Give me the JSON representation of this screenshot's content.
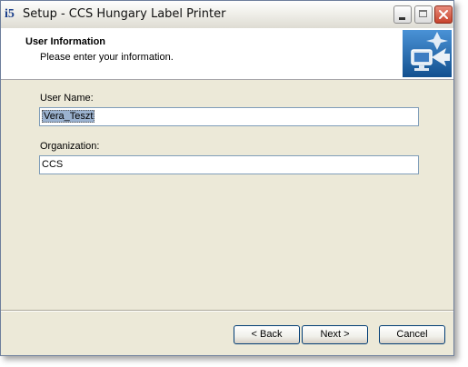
{
  "window": {
    "title": "Setup - CCS Hungary Label Printer",
    "app_icon_glyph": "i5",
    "icons": [
      "setup-app-icon",
      "minimize-icon",
      "maximize-icon",
      "close-icon",
      "wizard-computer-icon"
    ]
  },
  "header": {
    "title": "User Information",
    "subtitle": "Please enter your information."
  },
  "form": {
    "user_name_label": "User Name:",
    "user_name_value": "Vera_Teszt",
    "organization_label": "Organization:",
    "organization_value": "CCS"
  },
  "buttons": {
    "back": "< Back",
    "next": "Next >",
    "cancel": "Cancel"
  },
  "colors": {
    "dialog_background": "#ece9d8",
    "input_border": "#7f9db9",
    "button_border": "#003c74",
    "close_button": "#c7432c"
  }
}
